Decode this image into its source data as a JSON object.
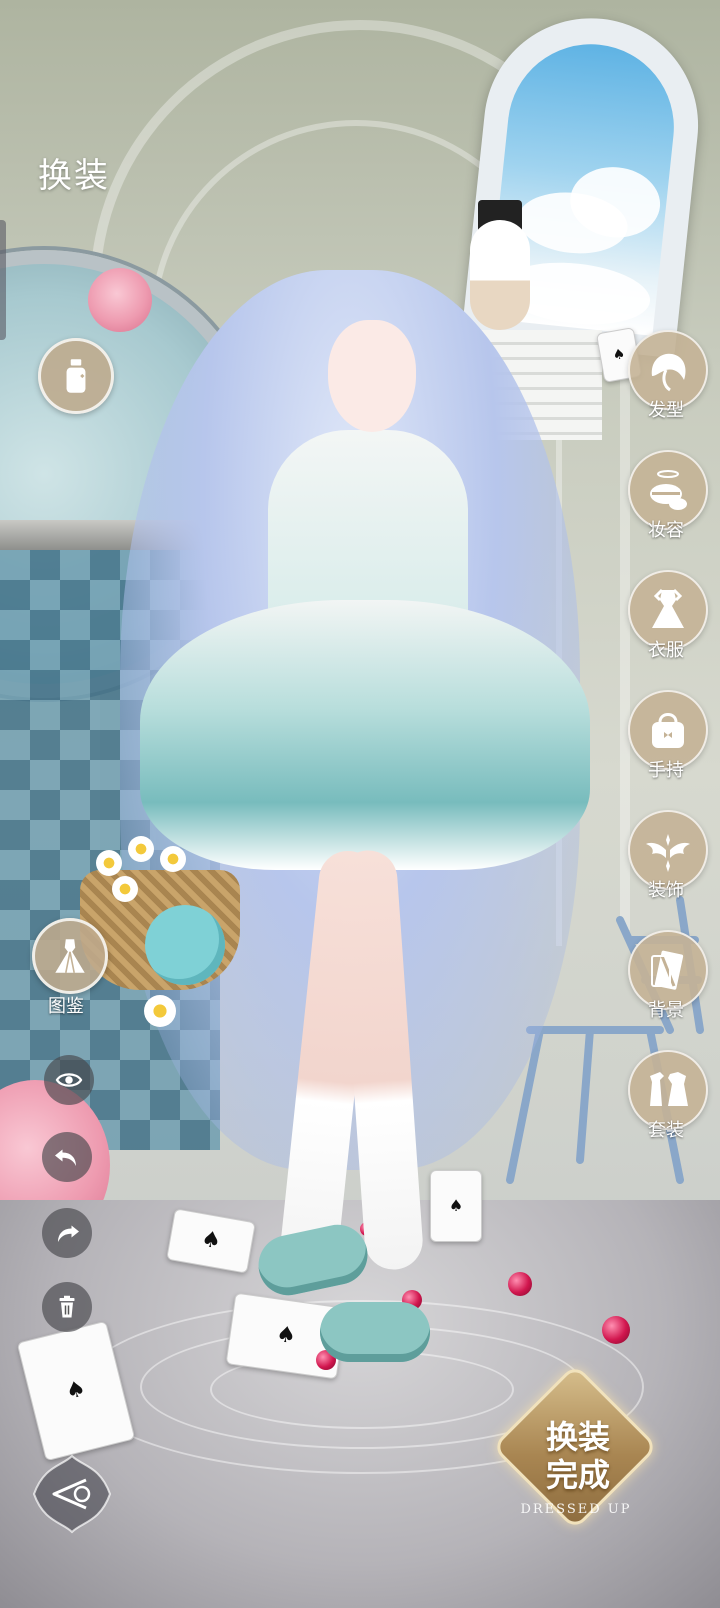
{
  "header": {
    "title": "换装"
  },
  "right_menu": {
    "items": [
      {
        "label": "发型",
        "icon": "hair-icon"
      },
      {
        "label": "妆容",
        "icon": "makeup-icon"
      },
      {
        "label": "衣服",
        "icon": "dress-icon"
      },
      {
        "label": "手持",
        "icon": "handbag-icon"
      },
      {
        "label": "装饰",
        "icon": "wings-icon"
      },
      {
        "label": "背景",
        "icon": "background-icon"
      },
      {
        "label": "套装",
        "icon": "outfit-set-icon"
      }
    ]
  },
  "left_tools": {
    "spray_icon": "spray-bottle-icon",
    "atlas_label": "图鉴",
    "atlas_icon": "gown-icon",
    "visibility_icon": "eye-icon",
    "undo_icon": "undo-icon",
    "redo_icon": "redo-icon",
    "delete_icon": "trash-icon"
  },
  "footer": {
    "back_icon": "back-arrow-icon",
    "done_label": "换装完成",
    "done_label_line1": "换装",
    "done_label_line2": "完成",
    "done_sub": "DRESSED UP"
  },
  "colors": {
    "menu_button": "#c4b296",
    "done_gold": "#a98652",
    "label_text": "#ffffff"
  }
}
